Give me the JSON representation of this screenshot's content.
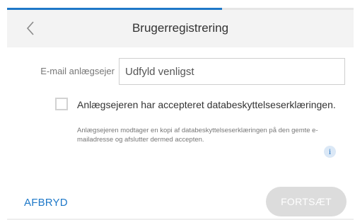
{
  "header": {
    "title": "Brugerregistrering",
    "progress_fraction": 0.62
  },
  "form": {
    "email_label": "E-mail anlægsejer",
    "email_value": "",
    "email_placeholder": "Udfyld venligst",
    "consent_checked": false,
    "consent_label": "Anlægsejeren har accepteret databeskyttelseserklæringen.",
    "note": "Anlægsejeren modtager en kopi af databeskyttelseserklæringen på den gemte e-mailadresse og afslutter dermed accepten.",
    "info_glyph": "i"
  },
  "footer": {
    "cancel_label": "AFBRYD",
    "continue_label": "FORTSÆT",
    "continue_enabled": false
  },
  "colors": {
    "accent": "#1e78c8",
    "header_bg": "#f3f3f3",
    "disabled_button": "#dcdcdc"
  },
  "icons": {
    "back": "chevron-left-icon",
    "info": "info-icon"
  }
}
